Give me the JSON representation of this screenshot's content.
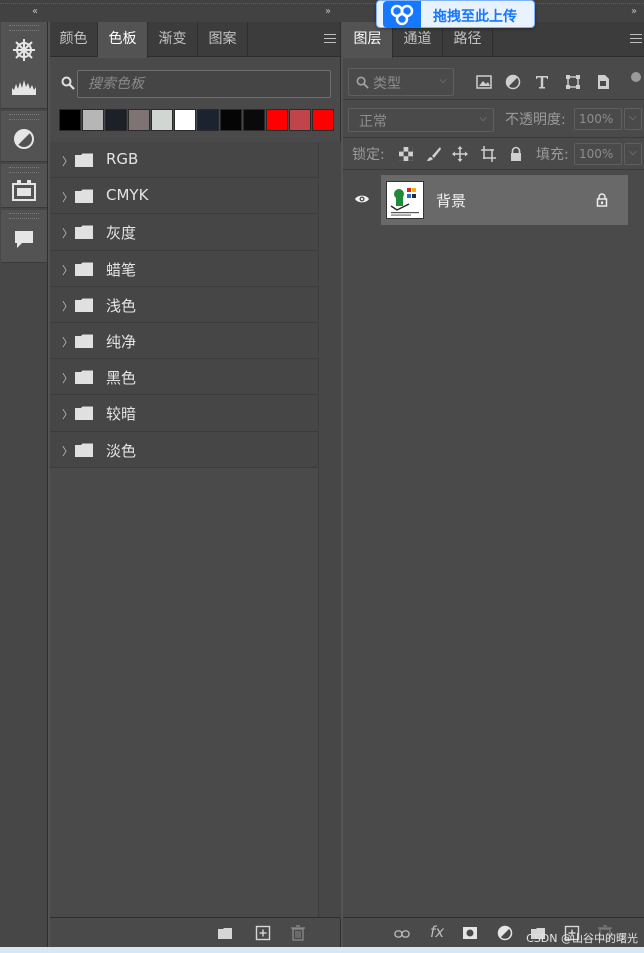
{
  "topbar": {
    "collapse_left": "‹‹",
    "collapse_mid": "››",
    "collapse_right": "››"
  },
  "upload_badge": {
    "label": "拖拽至此上传"
  },
  "swatches_panel": {
    "tabs": [
      {
        "label": "颜色",
        "active": false
      },
      {
        "label": "色板",
        "active": true
      },
      {
        "label": "渐变",
        "active": false
      },
      {
        "label": "图案",
        "active": false
      }
    ],
    "search_placeholder": "搜索色板",
    "recent_colors": [
      "#000000",
      "#b6b6b6",
      "#1c2128",
      "#7f7474",
      "#d2d6d3",
      "#ffffff",
      "#1b2230",
      "#050505",
      "#0a0a0a",
      "#ff0000",
      "#c0444a",
      "#ff0000"
    ],
    "groups": [
      {
        "label": "RGB"
      },
      {
        "label": "CMYK"
      },
      {
        "label": "灰度"
      },
      {
        "label": "蜡笔"
      },
      {
        "label": "浅色"
      },
      {
        "label": "纯净"
      },
      {
        "label": "黑色"
      },
      {
        "label": "较暗"
      },
      {
        "label": "淡色"
      }
    ],
    "footer_icons": [
      "folder-icon",
      "new-swatch-icon",
      "trash-icon"
    ]
  },
  "layers_panel": {
    "tabs": [
      {
        "label": "图层",
        "active": true
      },
      {
        "label": "通道",
        "active": false
      },
      {
        "label": "路径",
        "active": false
      }
    ],
    "filter_kind": "类型",
    "blend_mode": "正常",
    "opacity_label": "不透明度:",
    "opacity_value": "100%",
    "lock_label": "锁定:",
    "fill_label": "填充:",
    "fill_value": "100%",
    "layers": [
      {
        "name": "背景",
        "visible": true,
        "locked": true
      }
    ],
    "footer_icons": [
      "link-icon",
      "fx-icon",
      "mask-icon",
      "adjustment-icon",
      "group-folder-icon",
      "new-layer-icon",
      "delete-icon"
    ]
  },
  "watermark": "CSDN @山谷中的曙光"
}
